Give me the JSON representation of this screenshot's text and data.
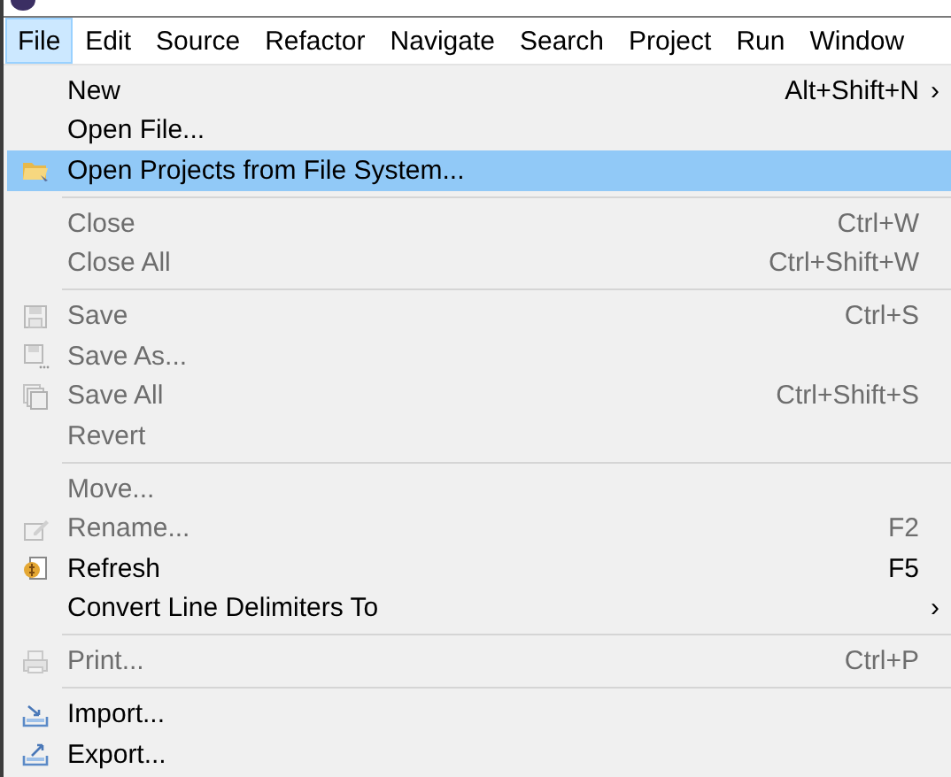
{
  "menubar": [
    {
      "label": "File",
      "selected": true
    },
    {
      "label": "Edit",
      "selected": false
    },
    {
      "label": "Source",
      "selected": false
    },
    {
      "label": "Refactor",
      "selected": false
    },
    {
      "label": "Navigate",
      "selected": false
    },
    {
      "label": "Search",
      "selected": false
    },
    {
      "label": "Project",
      "selected": false
    },
    {
      "label": "Run",
      "selected": false
    },
    {
      "label": "Window",
      "selected": false
    }
  ],
  "menu": {
    "items": [
      {
        "kind": "item",
        "label": "New",
        "shortcut": "Alt+Shift+N",
        "submenu_arrow": "›",
        "disabled": false,
        "selected": false
      },
      {
        "kind": "item",
        "label": "Open File...",
        "disabled": false,
        "selected": false
      },
      {
        "kind": "item",
        "label": "Open Projects from File System...",
        "disabled": false,
        "selected": true
      },
      {
        "kind": "separator"
      },
      {
        "kind": "item",
        "label": "Close",
        "shortcut": "Ctrl+W",
        "disabled": true,
        "selected": false
      },
      {
        "kind": "item",
        "label": "Close All",
        "shortcut": "Ctrl+Shift+W",
        "disabled": true,
        "selected": false
      },
      {
        "kind": "separator"
      },
      {
        "kind": "item",
        "label": "Save",
        "shortcut": "Ctrl+S",
        "disabled": true,
        "selected": false
      },
      {
        "kind": "item",
        "label": "Save As...",
        "disabled": true,
        "selected": false
      },
      {
        "kind": "item",
        "label": "Save All",
        "shortcut": "Ctrl+Shift+S",
        "disabled": true,
        "selected": false
      },
      {
        "kind": "item",
        "label": "Revert",
        "disabled": true,
        "selected": false
      },
      {
        "kind": "separator"
      },
      {
        "kind": "item",
        "label": "Move...",
        "disabled": true,
        "selected": false
      },
      {
        "kind": "item",
        "label": "Rename...",
        "shortcut": "F2",
        "disabled": true,
        "selected": false
      },
      {
        "kind": "item",
        "label": "Refresh",
        "shortcut": "F5",
        "disabled": false,
        "selected": false
      },
      {
        "kind": "item",
        "label": "Convert Line Delimiters To",
        "submenu_arrow": "›",
        "disabled": false,
        "selected": false
      },
      {
        "kind": "separator"
      },
      {
        "kind": "item",
        "label": "Print...",
        "shortcut": "Ctrl+P",
        "disabled": true,
        "selected": false
      },
      {
        "kind": "separator"
      },
      {
        "kind": "item",
        "label": "Import...",
        "disabled": false,
        "selected": false
      },
      {
        "kind": "item",
        "label": "Export...",
        "disabled": false,
        "selected": false
      }
    ]
  }
}
